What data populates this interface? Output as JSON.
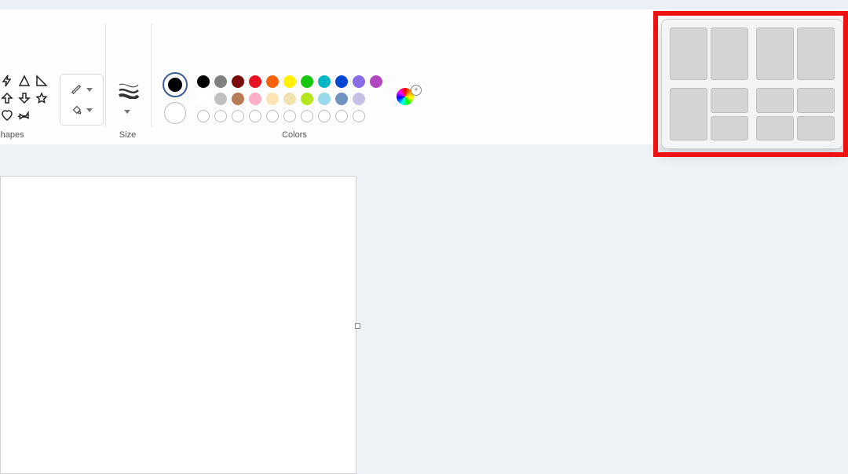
{
  "ribbon": {
    "shapes_label": "Shapes",
    "size_label": "Size",
    "colors_label": "Colors"
  },
  "colors": {
    "primary": "#000000",
    "secondary": "#ffffff",
    "row1": [
      "#000000",
      "#808080",
      "#7b0a0a",
      "#e81123",
      "#f7630c",
      "#fff100",
      "#16c60c",
      "#00b7c3",
      "#0046d5",
      "#886ce4",
      "#b146c2"
    ],
    "row2": [
      "#ffffff",
      "#c0c0c0",
      "#b97a56",
      "#ffaec9",
      "#ffe4b5",
      "#efe4b0",
      "#b5e61d",
      "#99d9ea",
      "#7092be",
      "#c8bfe7"
    ]
  },
  "snap_layouts": {
    "options": [
      "two-column",
      "two-column-wide",
      "left-tall-right-stack",
      "two-by-two"
    ]
  }
}
